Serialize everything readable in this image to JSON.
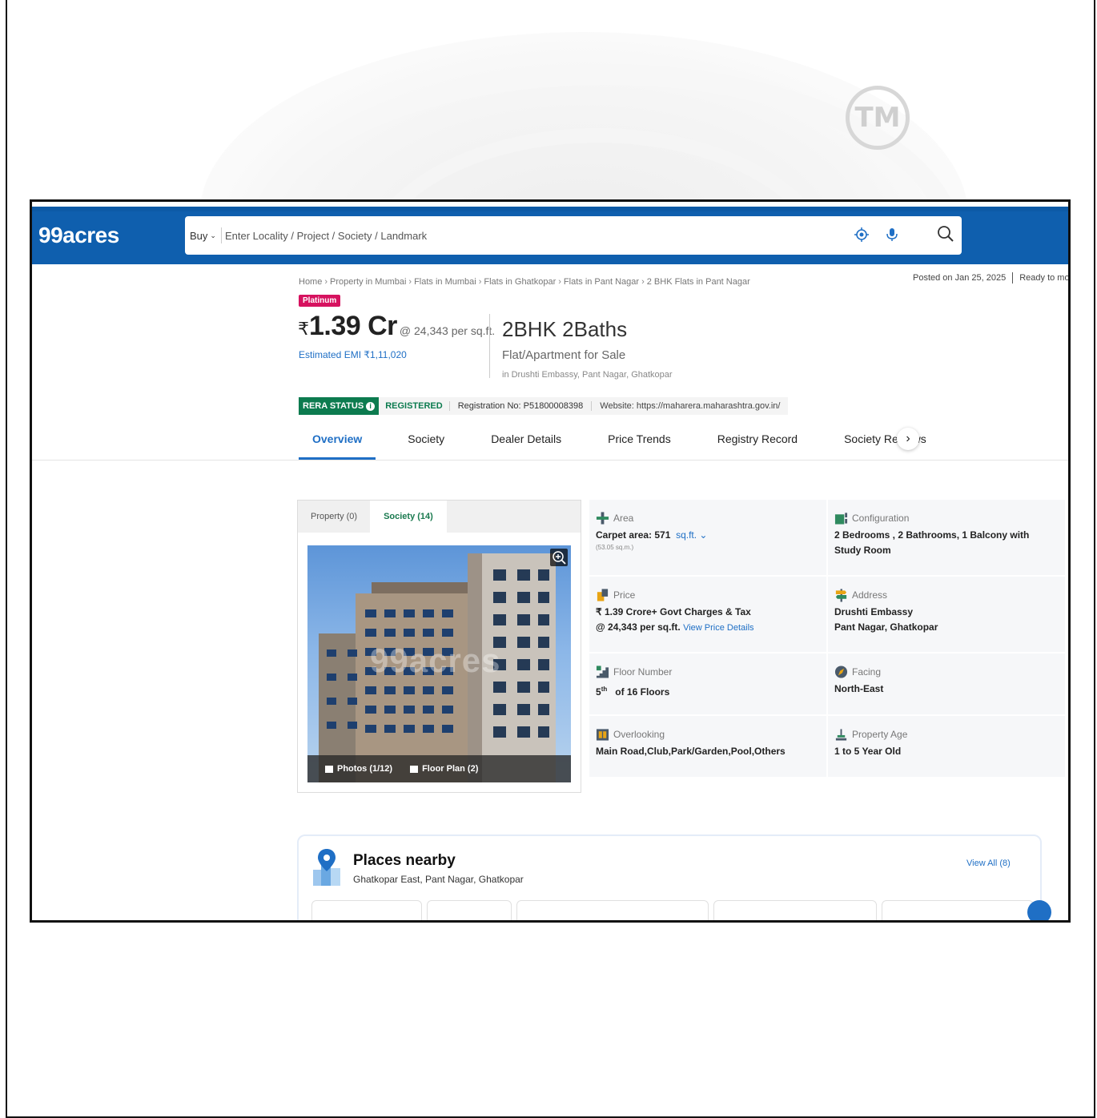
{
  "watermark": {
    "tm_label": "TM"
  },
  "header": {
    "logo": "99acres",
    "search": {
      "mode": "Buy",
      "placeholder": "Enter Locality / Project / Society / Landmark"
    }
  },
  "breadcrumb": [
    "Home",
    "Property in Mumbai",
    "Flats in Mumbai",
    "Flats in Ghatkopar",
    "Flats in Pant Nagar",
    "2 BHK Flats in Pant Nagar"
  ],
  "posted": {
    "date": "Posted on Jan 25, 2025",
    "status": "Ready to move"
  },
  "listing": {
    "badge": "Platinum",
    "currency_symbol": "₹",
    "price": "1.39 Cr",
    "price_per_sqft": "@ 24,343 per sq.ft.",
    "emi": "Estimated EMI ₹1,11,020",
    "title": "2BHK 2Baths",
    "subtitle": "Flat/Apartment for Sale",
    "location": "in Drushti Embassy, Pant Nagar, Ghatkopar"
  },
  "rera": {
    "status_label": "RERA STATUS",
    "status_value": "REGISTERED",
    "registration": "Registration No: P51800008398",
    "website": "Website: https://maharera.maharashtra.gov.in/"
  },
  "tabs": [
    "Overview",
    "Society",
    "Dealer Details",
    "Price Trends",
    "Registry Record",
    "Society Reviews"
  ],
  "media": {
    "tabs": [
      "Property (0)",
      "Society (14)"
    ],
    "watermark": "99acres",
    "photos_label": "Photos (1/12)",
    "floorplan_label": "Floor Plan (2)"
  },
  "details": {
    "area": {
      "label": "Area",
      "value": "Carpet area: 571",
      "unit": "sq.ft.",
      "sub": "(53.05 sq.m.)"
    },
    "configuration": {
      "label": "Configuration",
      "value": "2 Bedrooms , 2 Bathrooms, 1 Balcony with Study Room"
    },
    "price": {
      "label": "Price",
      "line1": "₹ 1.39 Crore+ Govt Charges & Tax",
      "line2": "@ 24,343 per sq.ft.",
      "link": "View Price Details"
    },
    "address": {
      "label": "Address",
      "line1": "Drushti Embassy",
      "line2": "Pant Nagar, Ghatkopar"
    },
    "floor": {
      "label": "Floor Number",
      "floor_num": "5",
      "floor_sup": "th",
      "floor_rest": "of 16 Floors"
    },
    "facing": {
      "label": "Facing",
      "value": "North-East"
    },
    "overlooking": {
      "label": "Overlooking",
      "value": "Main Road,Club,Park/Garden,Pool,Others"
    },
    "age": {
      "label": "Property Age",
      "value": "1 to 5 Year Old"
    }
  },
  "places": {
    "title": "Places nearby",
    "subtitle": "Ghatkopar East, Pant Nagar, Ghatkopar",
    "view_all": "View All (8)"
  },
  "colors": {
    "brand_blue": "#0f5fae",
    "accent_link": "#1f6fc5",
    "rera_green": "#0c7b4f",
    "platinum": "#d6125f"
  }
}
